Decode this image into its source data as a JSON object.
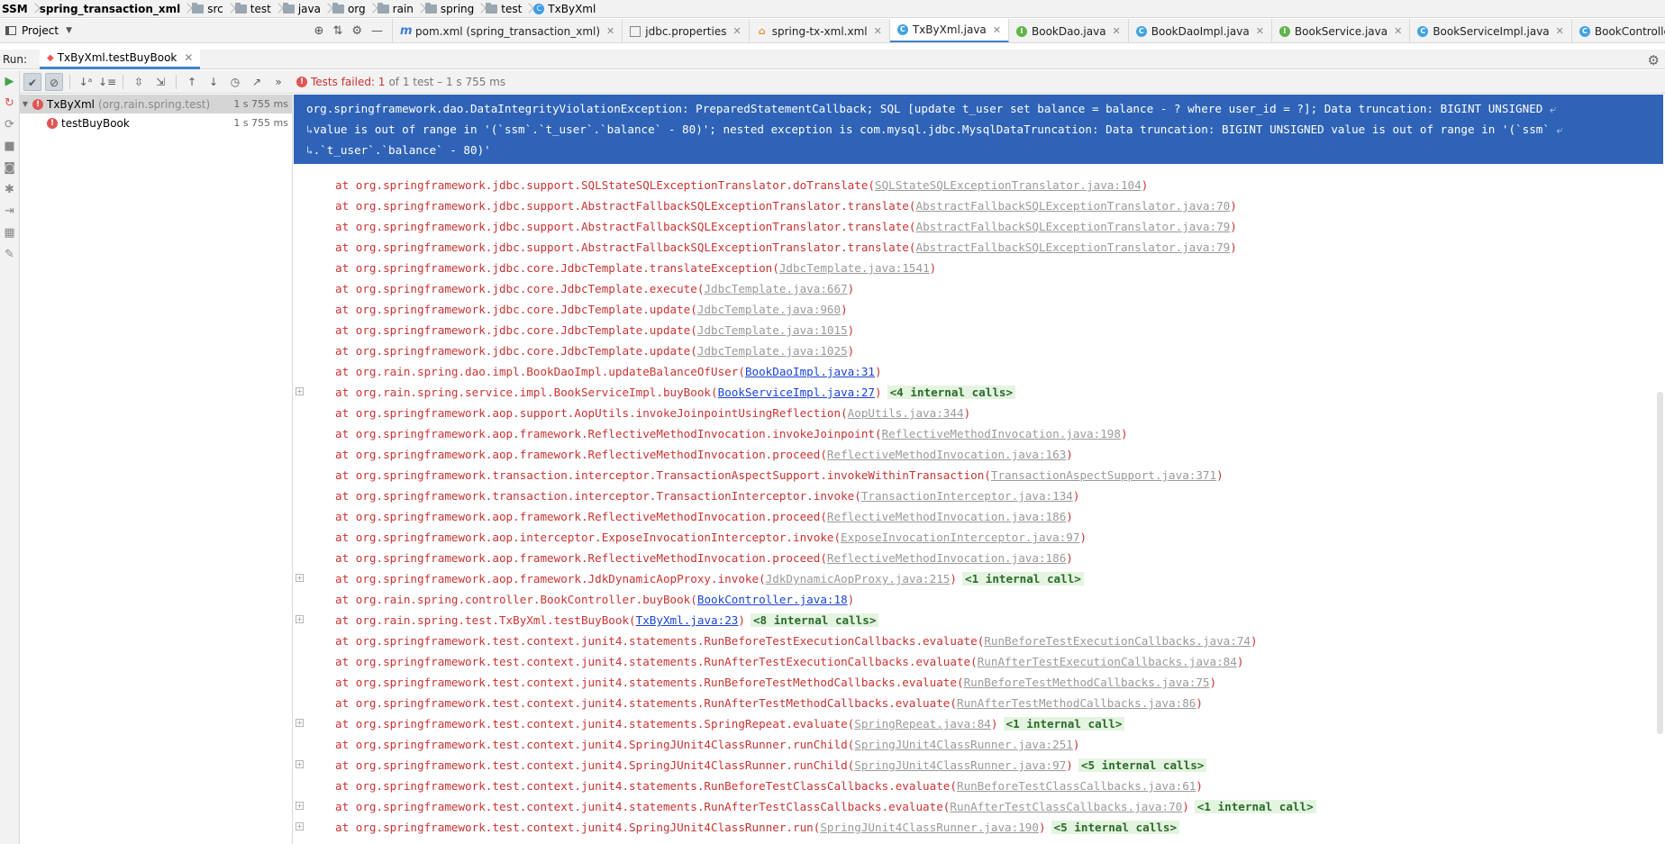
{
  "breadcrumb": [
    {
      "label": "SSM",
      "kind": "root"
    },
    {
      "label": "spring_transaction_xml",
      "kind": "module"
    },
    {
      "label": "src",
      "kind": "folder"
    },
    {
      "label": "test",
      "kind": "folder"
    },
    {
      "label": "java",
      "kind": "folder"
    },
    {
      "label": "org",
      "kind": "folder"
    },
    {
      "label": "rain",
      "kind": "folder"
    },
    {
      "label": "spring",
      "kind": "folder"
    },
    {
      "label": "test",
      "kind": "folder"
    },
    {
      "label": "TxByXml",
      "kind": "class"
    }
  ],
  "project_pane": {
    "label": "Project"
  },
  "editor_tabs": [
    {
      "label": "pom.xml (spring_transaction_xml)",
      "icon": "m",
      "active": false
    },
    {
      "label": "jdbc.properties",
      "icon": "p",
      "active": false
    },
    {
      "label": "spring-tx-xml.xml",
      "icon": "x",
      "active": false
    },
    {
      "label": "TxByXml.java",
      "icon": "c",
      "active": true
    },
    {
      "label": "BookDao.java",
      "icon": "i",
      "active": false
    },
    {
      "label": "BookDaoImpl.java",
      "icon": "c",
      "active": false
    },
    {
      "label": "BookService.java",
      "icon": "i",
      "active": false
    },
    {
      "label": "BookServiceImpl.java",
      "icon": "c",
      "active": false
    },
    {
      "label": "BookController.java",
      "icon": "c",
      "active": false
    }
  ],
  "run": {
    "label": "Run:",
    "tab_label": "TxByXml.testBuyBook"
  },
  "status": {
    "failed_text": "Tests failed: 1",
    "detail_text": "of 1 test – 1 s 755 ms"
  },
  "tree": {
    "root": {
      "label": "TxByXml",
      "package": "(org.rain.spring.test)",
      "duration": "1 s 755 ms"
    },
    "child": {
      "label": "testBuyBook",
      "duration": "1 s 755 ms"
    }
  },
  "exception": {
    "line1": "org.springframework.dao.DataIntegrityViolationException: PreparedStatementCallback; SQL [update t_user set balance = balance - ? where user_id = ?]; Data truncation: BIGINT UNSIGNED",
    "line2": "value is out of range in '(`ssm`.`t_user`.`balance` - 80)'; nested exception is com.mysql.jdbc.MysqlDataTruncation: Data truncation: BIGINT UNSIGNED value is out of range in '(`ssm`",
    "line3": ".`t_user`.`balance` - 80)'"
  },
  "stack": [
    {
      "method": "at org.springframework.jdbc.support.SQLStateSQLExceptionTranslator.doTranslate(",
      "loc": "SQLStateSQLExceptionTranslator.java:104",
      "own": false,
      "internal": "",
      "fold": false
    },
    {
      "method": "at org.springframework.jdbc.support.AbstractFallbackSQLExceptionTranslator.translate(",
      "loc": "AbstractFallbackSQLExceptionTranslator.java:70",
      "own": false,
      "internal": "",
      "fold": false
    },
    {
      "method": "at org.springframework.jdbc.support.AbstractFallbackSQLExceptionTranslator.translate(",
      "loc": "AbstractFallbackSQLExceptionTranslator.java:79",
      "own": false,
      "internal": "",
      "fold": false
    },
    {
      "method": "at org.springframework.jdbc.support.AbstractFallbackSQLExceptionTranslator.translate(",
      "loc": "AbstractFallbackSQLExceptionTranslator.java:79",
      "own": false,
      "internal": "",
      "fold": false
    },
    {
      "method": "at org.springframework.jdbc.core.JdbcTemplate.translateException(",
      "loc": "JdbcTemplate.java:1541",
      "own": false,
      "internal": "",
      "fold": false
    },
    {
      "method": "at org.springframework.jdbc.core.JdbcTemplate.execute(",
      "loc": "JdbcTemplate.java:667",
      "own": false,
      "internal": "",
      "fold": false
    },
    {
      "method": "at org.springframework.jdbc.core.JdbcTemplate.update(",
      "loc": "JdbcTemplate.java:960",
      "own": false,
      "internal": "",
      "fold": false
    },
    {
      "method": "at org.springframework.jdbc.core.JdbcTemplate.update(",
      "loc": "JdbcTemplate.java:1015",
      "own": false,
      "internal": "",
      "fold": false
    },
    {
      "method": "at org.springframework.jdbc.core.JdbcTemplate.update(",
      "loc": "JdbcTemplate.java:1025",
      "own": false,
      "internal": "",
      "fold": false
    },
    {
      "method": "at org.rain.spring.dao.impl.BookDaoImpl.updateBalanceOfUser(",
      "loc": "BookDaoImpl.java:31",
      "own": true,
      "internal": "",
      "fold": false
    },
    {
      "method": "at org.rain.spring.service.impl.BookServiceImpl.buyBook(",
      "loc": "BookServiceImpl.java:27",
      "own": true,
      "internal": "<4 internal calls>",
      "fold": true
    },
    {
      "method": "at org.springframework.aop.support.AopUtils.invokeJoinpointUsingReflection(",
      "loc": "AopUtils.java:344",
      "own": false,
      "internal": "",
      "fold": false
    },
    {
      "method": "at org.springframework.aop.framework.ReflectiveMethodInvocation.invokeJoinpoint(",
      "loc": "ReflectiveMethodInvocation.java:198",
      "own": false,
      "internal": "",
      "fold": false
    },
    {
      "method": "at org.springframework.aop.framework.ReflectiveMethodInvocation.proceed(",
      "loc": "ReflectiveMethodInvocation.java:163",
      "own": false,
      "internal": "",
      "fold": false
    },
    {
      "method": "at org.springframework.transaction.interceptor.TransactionAspectSupport.invokeWithinTransaction(",
      "loc": "TransactionAspectSupport.java:371",
      "own": false,
      "internal": "",
      "fold": false
    },
    {
      "method": "at org.springframework.transaction.interceptor.TransactionInterceptor.invoke(",
      "loc": "TransactionInterceptor.java:134",
      "own": false,
      "internal": "",
      "fold": false
    },
    {
      "method": "at org.springframework.aop.framework.ReflectiveMethodInvocation.proceed(",
      "loc": "ReflectiveMethodInvocation.java:186",
      "own": false,
      "internal": "",
      "fold": false
    },
    {
      "method": "at org.springframework.aop.interceptor.ExposeInvocationInterceptor.invoke(",
      "loc": "ExposeInvocationInterceptor.java:97",
      "own": false,
      "internal": "",
      "fold": false
    },
    {
      "method": "at org.springframework.aop.framework.ReflectiveMethodInvocation.proceed(",
      "loc": "ReflectiveMethodInvocation.java:186",
      "own": false,
      "internal": "",
      "fold": false
    },
    {
      "method": "at org.springframework.aop.framework.JdkDynamicAopProxy.invoke(",
      "loc": "JdkDynamicAopProxy.java:215",
      "own": false,
      "internal": "<1 internal call>",
      "fold": true
    },
    {
      "method": "at org.rain.spring.controller.BookController.buyBook(",
      "loc": "BookController.java:18",
      "own": true,
      "internal": "",
      "fold": false
    },
    {
      "method": "at org.rain.spring.test.TxByXml.testBuyBook(",
      "loc": "TxByXml.java:23",
      "own": true,
      "internal": "<8 internal calls>",
      "fold": true
    },
    {
      "method": "at org.springframework.test.context.junit4.statements.RunBeforeTestExecutionCallbacks.evaluate(",
      "loc": "RunBeforeTestExecutionCallbacks.java:74",
      "own": false,
      "internal": "",
      "fold": false
    },
    {
      "method": "at org.springframework.test.context.junit4.statements.RunAfterTestExecutionCallbacks.evaluate(",
      "loc": "RunAfterTestExecutionCallbacks.java:84",
      "own": false,
      "internal": "",
      "fold": false
    },
    {
      "method": "at org.springframework.test.context.junit4.statements.RunBeforeTestMethodCallbacks.evaluate(",
      "loc": "RunBeforeTestMethodCallbacks.java:75",
      "own": false,
      "internal": "",
      "fold": false
    },
    {
      "method": "at org.springframework.test.context.junit4.statements.RunAfterTestMethodCallbacks.evaluate(",
      "loc": "RunAfterTestMethodCallbacks.java:86",
      "own": false,
      "internal": "",
      "fold": false
    },
    {
      "method": "at org.springframework.test.context.junit4.statements.SpringRepeat.evaluate(",
      "loc": "SpringRepeat.java:84",
      "own": false,
      "internal": "<1 internal call>",
      "fold": true
    },
    {
      "method": "at org.springframework.test.context.junit4.SpringJUnit4ClassRunner.runChild(",
      "loc": "SpringJUnit4ClassRunner.java:251",
      "own": false,
      "internal": "",
      "fold": false
    },
    {
      "method": "at org.springframework.test.context.junit4.SpringJUnit4ClassRunner.runChild(",
      "loc": "SpringJUnit4ClassRunner.java:97",
      "own": false,
      "internal": "<5 internal calls>",
      "fold": true
    },
    {
      "method": "at org.springframework.test.context.junit4.statements.RunBeforeTestClassCallbacks.evaluate(",
      "loc": "RunBeforeTestClassCallbacks.java:61",
      "own": false,
      "internal": "",
      "fold": false
    },
    {
      "method": "at org.springframework.test.context.junit4.statements.RunAfterTestClassCallbacks.evaluate(",
      "loc": "RunAfterTestClassCallbacks.java:70",
      "own": false,
      "internal": "<1 internal call>",
      "fold": true
    },
    {
      "method": "at org.springframework.test.context.junit4.SpringJUnit4ClassRunner.run(",
      "loc": "SpringJUnit4ClassRunner.java:190",
      "own": false,
      "internal": "<5 internal calls>",
      "fold": true
    }
  ],
  "colors": {
    "error_text": "#c93333",
    "selection": "#2f63b7",
    "own_link": "#1a44d6",
    "internal_badge": "#e4f4e0"
  }
}
